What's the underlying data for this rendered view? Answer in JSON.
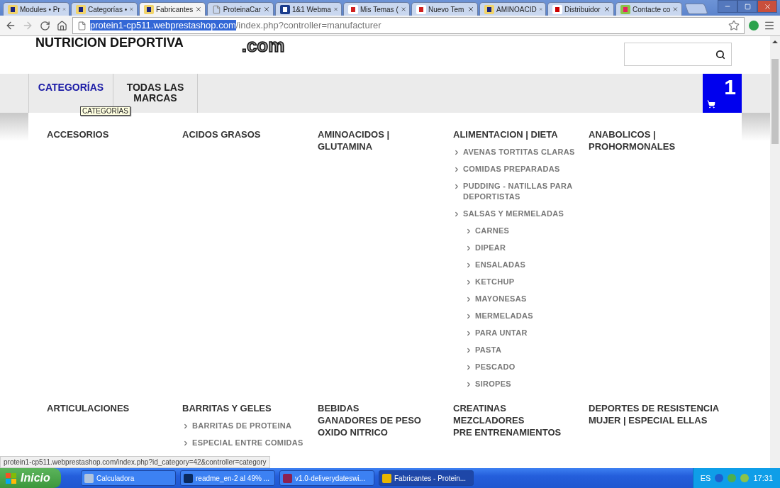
{
  "browser": {
    "tabs": [
      {
        "title": "Modules • Pr",
        "kind": "shop",
        "selected": false
      },
      {
        "title": "Categorías •",
        "kind": "shop",
        "selected": false
      },
      {
        "title": "Fabricantes",
        "kind": "shop",
        "selected": true
      },
      {
        "title": "ProteinaCar",
        "kind": "document",
        "selected": false
      },
      {
        "title": "1&1 Webma",
        "kind": "mail",
        "selected": false
      },
      {
        "title": "Mis Temas (",
        "kind": "themes",
        "selected": false
      },
      {
        "title": "Nuevo Tem",
        "kind": "themes",
        "selected": false
      },
      {
        "title": "AMINOACID",
        "kind": "shop",
        "selected": false
      },
      {
        "title": "Distribuidor",
        "kind": "distributor",
        "selected": false
      },
      {
        "title": "Contacte co",
        "kind": "contact",
        "selected": false
      }
    ],
    "address": {
      "host": "protein1-cp511.webprestashop.com",
      "path": "/index.php?controller=manufacturer"
    }
  },
  "header": {
    "brand": "NUTRICION DEPORTIVA",
    "logo": ".com"
  },
  "nav": {
    "items": [
      {
        "label": "CATEGORÍAS",
        "selected": true
      },
      {
        "label": "TODAS LAS MARCAS",
        "selected": false
      }
    ],
    "tooltip": "CATEGORÍAS",
    "cart_count": "1"
  },
  "menu": {
    "rows": [
      [
        {
          "headings": [
            "ACCESORIOS"
          ]
        },
        {
          "headings": [
            "ACIDOS GRASOS"
          ]
        },
        {
          "headings": [
            "AMINOACIDOS | GLUTAMINA"
          ]
        },
        {
          "headings": [
            "ALIMENTACION | DIETA"
          ],
          "children": [
            {
              "label": "AVENAS TORTITAS CLARAS"
            },
            {
              "label": "COMIDAS PREPARADAS"
            },
            {
              "label": "PUDDING - NATILLAS PARA DEPORTISTAS"
            },
            {
              "label": "SALSAS Y MERMELADAS",
              "children": [
                {
                  "label": "CARNES"
                },
                {
                  "label": "DIPEAR"
                },
                {
                  "label": "ENSALADAS"
                },
                {
                  "label": "KETCHUP"
                },
                {
                  "label": "MAYONESAS"
                },
                {
                  "label": "MERMELADAS"
                },
                {
                  "label": "PARA UNTAR"
                },
                {
                  "label": "PASTA"
                },
                {
                  "label": "PESCADO"
                },
                {
                  "label": "SIROPES"
                }
              ]
            }
          ]
        },
        {
          "headings": [
            "ANABOLICOS | PROHORMONALES"
          ]
        }
      ],
      [
        {
          "headings": [
            "ARTICULACIONES"
          ]
        },
        {
          "headings": [
            "BARRITAS Y GELES"
          ],
          "children": [
            {
              "label": "BARRITAS DE PROTEINA"
            },
            {
              "label": "ESPECIAL ENTRE COMIDAS"
            }
          ]
        },
        {
          "headings": [
            "BEBIDAS",
            "GANADORES DE PESO",
            "OXIDO NITRICO"
          ]
        },
        {
          "headings": [
            "CREATINAS",
            "MEZCLADORES",
            "PRE ENTRENAMIENTOS"
          ]
        },
        {
          "headings": [
            "DEPORTES DE RESISTENCIA",
            "MUJER | ESPECIAL ELLAS"
          ]
        }
      ]
    ]
  },
  "status_url": "protein1-cp511.webprestashop.com/index.php?id_category=42&controller=category",
  "taskbar": {
    "start": "Inicio",
    "items": [
      {
        "label": "Calculadora",
        "kind": "calculator",
        "selected": false
      },
      {
        "label": "readme_en-2 al 49% ...",
        "kind": "editor",
        "selected": false
      },
      {
        "label": "v1.0-deliverydateswi...",
        "kind": "archive",
        "selected": false
      },
      {
        "label": "Fabricantes - Protein...",
        "kind": "browser",
        "selected": true
      }
    ],
    "language": "ES",
    "time": "17:31"
  }
}
